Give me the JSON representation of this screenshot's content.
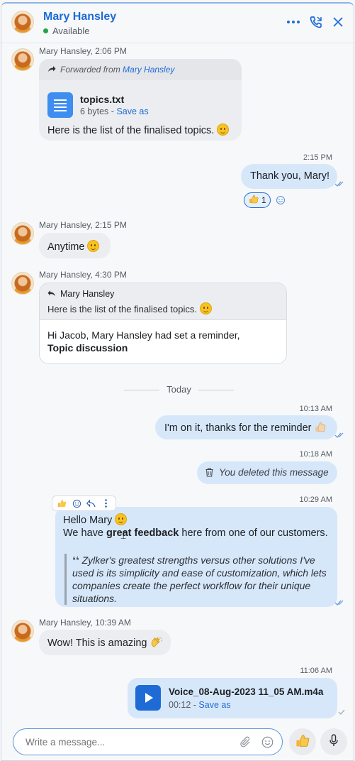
{
  "header": {
    "name": "Mary Hansley",
    "status": "Available",
    "icons": [
      "more-icon",
      "call-icon",
      "close-icon"
    ]
  },
  "messages": {
    "m1": {
      "sender": "Mary Hansley,",
      "time": "2:06 PM",
      "forward_prefix": "Forwarded from",
      "forward_from": "Mary Hansley",
      "file_name": "topics.txt",
      "file_size": "6 bytes",
      "separator": "-",
      "save_as": "Save as",
      "text": "Here is the list of the finalised topics."
    },
    "m2": {
      "time": "2:15 PM",
      "text": "Thank you, Mary!",
      "reaction_count": "1"
    },
    "m3": {
      "sender": "Mary Hansley,",
      "time": "2:15 PM",
      "text": "Anytime"
    },
    "m4": {
      "sender": "Mary Hansley,",
      "time": "4:30 PM",
      "reply_to_name": "Mary Hansley",
      "reply_to_text": "Here is the list of the finalised topics.",
      "line1": "Hi Jacob, Mary Hansley had set a reminder,",
      "line2": "Topic discussion"
    },
    "divider": "Today",
    "m5": {
      "time": "10:13 AM",
      "text": "I'm on it, thanks for the reminder"
    },
    "m6": {
      "time": "10:18 AM",
      "text": "You deleted this message"
    },
    "m7": {
      "time": "10:29 AM",
      "greeting": "Hello Mary",
      "line_pre": "We have",
      "line_bold": "great feedback",
      "line_post": "here from one of our customers.",
      "quote": "Zylker's greatest strengths versus other solutions I've used is its simplicity and ease of customization, which lets companies create the perfect workflow for their unique situations."
    },
    "m8": {
      "sender": "Mary Hansley,",
      "time": "10:39 AM",
      "text": "Wow! This is amazing"
    },
    "m9": {
      "time": "11:06 AM",
      "file_name": "Voice_08-Aug-2023 11_05 AM.m4a",
      "duration": "00:12",
      "separator": "-",
      "save_as": "Save as"
    }
  },
  "composer": {
    "placeholder": "Write a message..."
  },
  "colors": {
    "accent": "#1e6bd6",
    "outgoing_bubble": "#d7e7fa",
    "incoming_bubble": "#ebedf0",
    "status_green": "#23a24d"
  }
}
